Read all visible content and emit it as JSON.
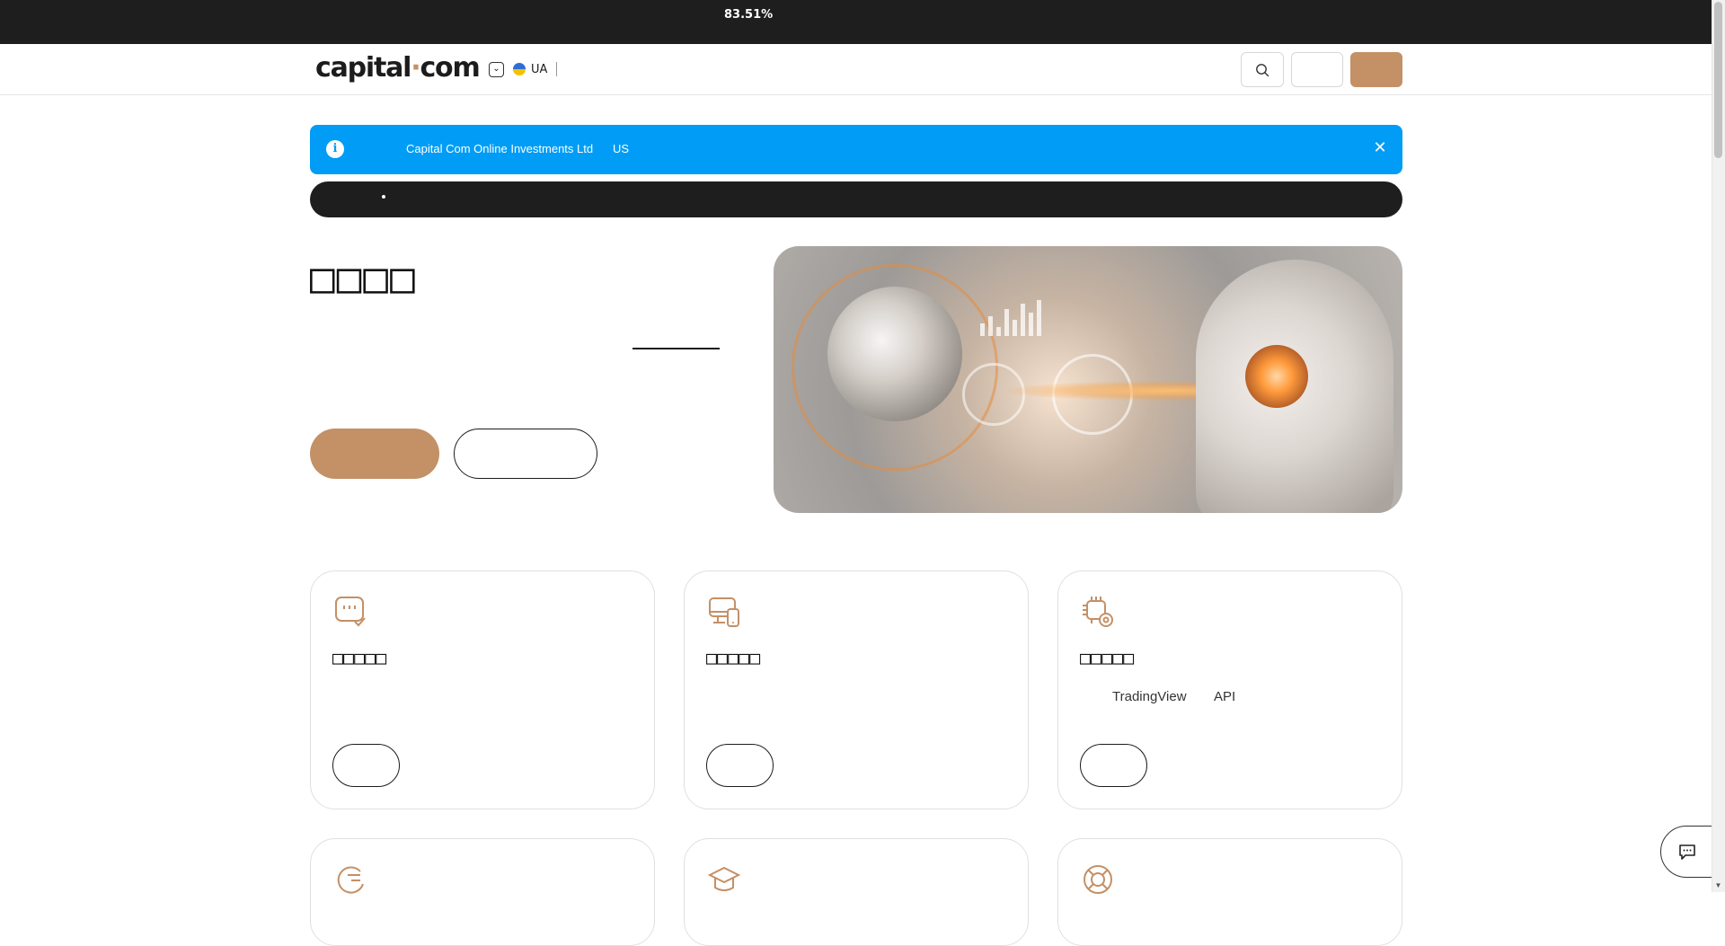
{
  "topbar": {
    "percent_text": "83.51%"
  },
  "header": {
    "logo_main": "capital",
    "logo_dot": "·",
    "logo_tail": "com",
    "language": {
      "code": "UA",
      "chevron": "⌄",
      "flag_icon": "ukraine-flag-icon"
    },
    "search_icon": "search-icon"
  },
  "banner": {
    "info_glyph": "i",
    "text": "Capital Com Online Investments Ltd",
    "region": "US",
    "close_glyph": "✕"
  },
  "hero": {
    "title": "□□□□"
  },
  "cards": [
    {
      "icon": "chat-check-icon",
      "title": "□□□□□",
      "desc": "",
      "desc2": ""
    },
    {
      "icon": "devices-icon",
      "title": "□□□□□",
      "desc": "",
      "desc2": ""
    },
    {
      "icon": "chip-gear-icon",
      "title": "□□□□□",
      "desc": "TradingView",
      "desc2": "API"
    }
  ],
  "cards_row2": [
    {
      "icon": "refresh-list-icon"
    },
    {
      "icon": "graduation-cap-icon"
    },
    {
      "icon": "lifebuoy-icon"
    }
  ],
  "colors": {
    "accent": "#c49066",
    "banner_blue": "#009cf5",
    "dark": "#1e1e1e"
  }
}
